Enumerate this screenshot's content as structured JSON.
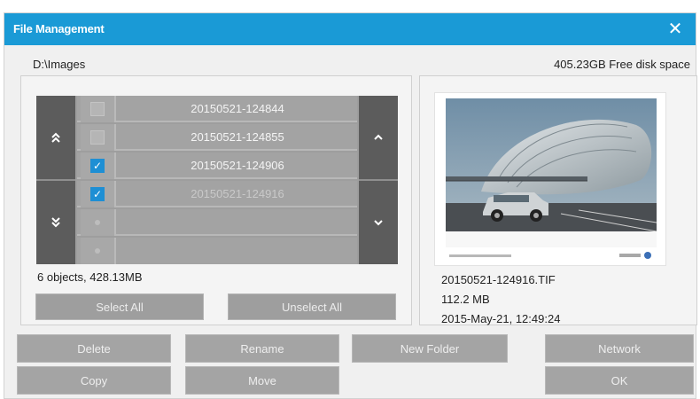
{
  "window": {
    "title": "File Management",
    "close_icon": "close-icon",
    "close_glyph": "✕",
    "accent_color": "#1a9ad6"
  },
  "header": {
    "path": "D:\\Images",
    "disk_space": "405.23GB Free disk space"
  },
  "file_list": {
    "scroll_icons": {
      "page_up": "⌃⌃",
      "line_up": "⌃",
      "page_down": "⌄⌄",
      "line_down": "⌄"
    },
    "rows": [
      {
        "name": "20150521-124844",
        "checked": false
      },
      {
        "name": "20150521-124855",
        "checked": false
      },
      {
        "name": "20150521-124906",
        "checked": true
      },
      {
        "name": "20150521-124916",
        "checked": true
      },
      {
        "name": "",
        "checked": false
      },
      {
        "name": "",
        "checked": false
      }
    ],
    "summary": "6 objects, 428.13MB",
    "select_all_label": "Select All",
    "unselect_all_label": "Unselect All"
  },
  "preview": {
    "file_name": "20150521-124916.TIF",
    "file_size": "112.2 MB",
    "date": "2015-May-21, 12:49:24"
  },
  "actions": {
    "delete_label": "Delete",
    "rename_label": "Rename",
    "new_folder_label": "New Folder",
    "network_label": "Network",
    "copy_label": "Copy",
    "move_label": "Move",
    "ok_label": "OK"
  }
}
